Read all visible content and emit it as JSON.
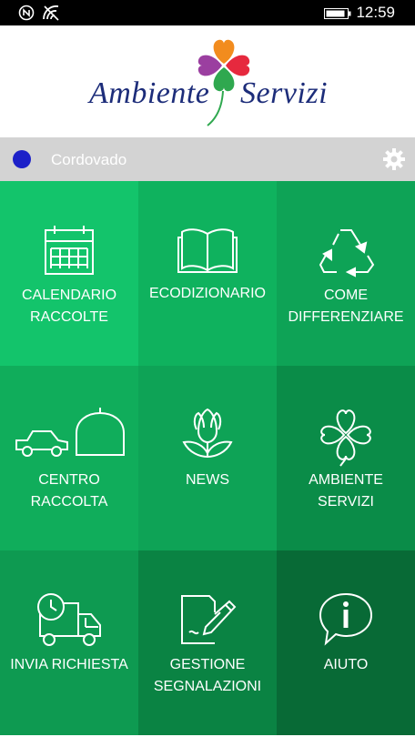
{
  "status_bar": {
    "time": "12:59",
    "icons": [
      "nfc-icon",
      "wifi-icon",
      "battery-icon"
    ]
  },
  "brand": {
    "name_left": "Ambiente",
    "name_right": "Servizi",
    "logo_icon": "clover-heart-logo",
    "logo_colors": [
      "#f28c1e",
      "#9b3fa0",
      "#e6293e",
      "#2fa84f"
    ]
  },
  "location": {
    "name": "Cordovado",
    "dot_color": "#1c20c8"
  },
  "tiles": [
    {
      "line1": "CALENDARIO",
      "line2": "RACCOLTE",
      "icon": "calendar-icon",
      "color": "#13c46b"
    },
    {
      "line1": "ECODIZIONARIO",
      "line2": "",
      "icon": "book-icon",
      "color": "#0fb25e"
    },
    {
      "line1": "COME",
      "line2": "DIFFERENZIARE",
      "icon": "recycle-icon",
      "color": "#0ea356"
    },
    {
      "line1": "CENTRO",
      "line2": "RACCOLTA",
      "icon": "car-bin-icon",
      "color": "#10ad5b"
    },
    {
      "line1": "NEWS",
      "line2": "",
      "icon": "tulip-icon",
      "color": "#0ea356"
    },
    {
      "line1": "AMBIENTE",
      "line2": "SERVIZI",
      "icon": "clover-icon",
      "color": "#0a8c48"
    },
    {
      "line1": "INVIA RICHIESTA",
      "line2": "",
      "icon": "truck-clock-icon",
      "color": "#0e9a51"
    },
    {
      "line1": "GESTIONE",
      "line2": "SEGNALAZIONI",
      "icon": "edit-document-icon",
      "color": "#0a8343"
    },
    {
      "line1": "AIUTO",
      "line2": "",
      "icon": "info-bubble-icon",
      "color": "#086a36"
    }
  ]
}
